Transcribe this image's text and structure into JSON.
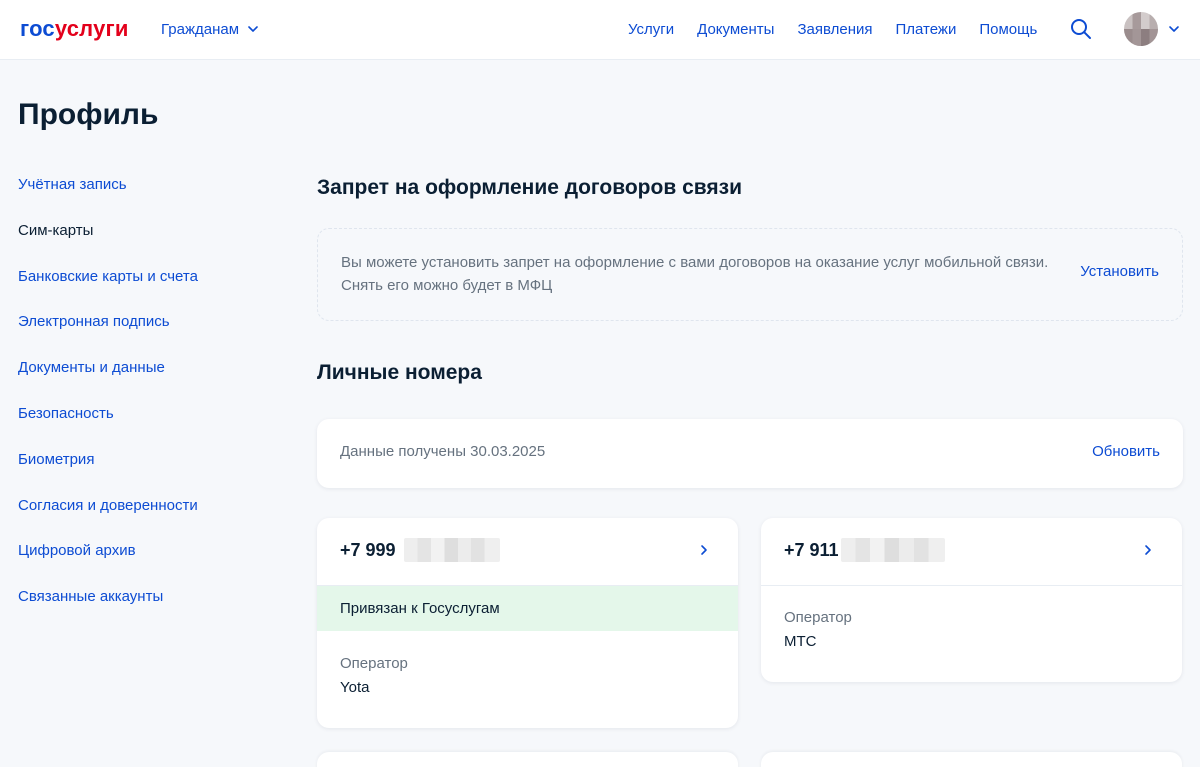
{
  "header": {
    "logo_part1": "гос",
    "logo_part2": "услуги",
    "audience_label": "Гражданам",
    "nav": [
      "Услуги",
      "Документы",
      "Заявления",
      "Платежи",
      "Помощь"
    ]
  },
  "page": {
    "title": "Профиль"
  },
  "sidebar": {
    "items": [
      "Учётная запись",
      "Сим-карты",
      "Банковские карты и счета",
      "Электронная подпись",
      "Документы и данные",
      "Безопасность",
      "Биометрия",
      "Согласия и доверенности",
      "Цифровой архив",
      "Связанные аккаунты"
    ],
    "active_index": 1
  },
  "ban": {
    "title": "Запрет на оформление договоров связи",
    "text": "Вы можете установить запрет на оформление с вами договоров на оказание услуг мобильной связи. Снять его можно будет в МФЦ",
    "action": "Установить"
  },
  "personal": {
    "title": "Личные номера",
    "updated_text": "Данные получены 30.03.2025",
    "refresh": "Обновить",
    "phones": [
      {
        "number_prefix": "+7 999",
        "linked_label": "Привязан к Госуслугам",
        "operator_label": "Оператор",
        "operator": "Yota"
      },
      {
        "number_prefix": "+7 911",
        "operator_label": "Оператор",
        "operator": "МТС"
      }
    ]
  },
  "colors": {
    "accent": "#0d4cd3",
    "brand_red": "#e3001b",
    "linked_bg": "#e4f7ea",
    "text": "#0b1f33",
    "muted": "#66727f"
  }
}
